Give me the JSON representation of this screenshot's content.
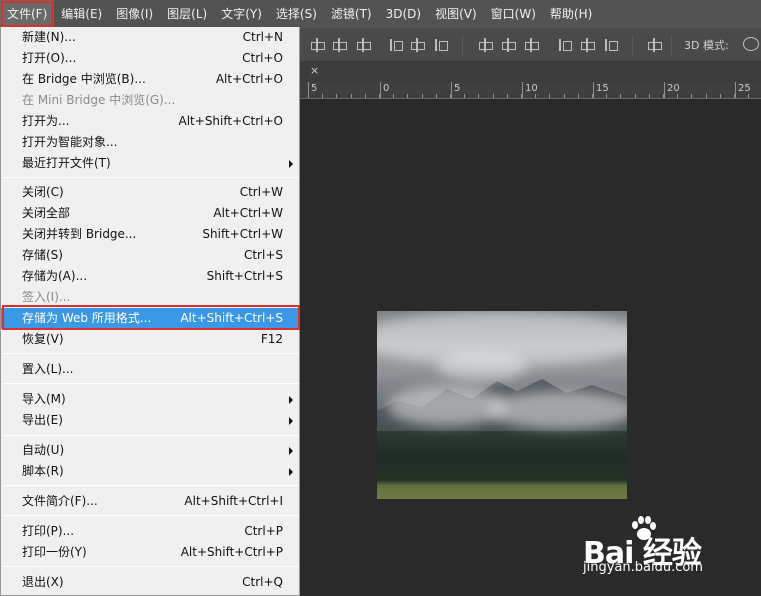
{
  "menubar": {
    "items": [
      "文件(F)",
      "编辑(E)",
      "图像(I)",
      "图层(L)",
      "文字(Y)",
      "选择(S)",
      "滤镜(T)",
      "3D(D)",
      "视图(V)",
      "窗口(W)",
      "帮助(H)"
    ]
  },
  "options": {
    "mode3d_label": "3D 模式:"
  },
  "tab": {
    "close": "×"
  },
  "ruler": {
    "labels": [
      "5",
      "0",
      "5",
      "10",
      "15",
      "20",
      "25"
    ]
  },
  "file_menu": {
    "items": [
      {
        "label": "新建(N)...",
        "shortcut": "Ctrl+N"
      },
      {
        "label": "打开(O)...",
        "shortcut": "Ctrl+O"
      },
      {
        "label": "在 Bridge 中浏览(B)...",
        "shortcut": "Alt+Ctrl+O"
      },
      {
        "label": "在 Mini Bridge 中浏览(G)...",
        "shortcut": "",
        "disabled": true
      },
      {
        "label": "打开为...",
        "shortcut": "Alt+Shift+Ctrl+O"
      },
      {
        "label": "打开为智能对象...",
        "shortcut": ""
      },
      {
        "label": "最近打开文件(T)",
        "shortcut": "",
        "submenu": true
      },
      {
        "label": "关闭(C)",
        "shortcut": "Ctrl+W"
      },
      {
        "label": "关闭全部",
        "shortcut": "Alt+Ctrl+W"
      },
      {
        "label": "关闭并转到 Bridge...",
        "shortcut": "Shift+Ctrl+W"
      },
      {
        "label": "存储(S)",
        "shortcut": "Ctrl+S"
      },
      {
        "label": "存储为(A)...",
        "shortcut": "Shift+Ctrl+S"
      },
      {
        "label": "签入(I)...",
        "shortcut": "",
        "disabled": true
      },
      {
        "label": "存储为 Web 所用格式...",
        "shortcut": "Alt+Shift+Ctrl+S",
        "highlighted": true
      },
      {
        "label": "恢复(V)",
        "shortcut": "F12"
      },
      {
        "label": "置入(L)...",
        "shortcut": ""
      },
      {
        "label": "导入(M)",
        "shortcut": "",
        "submenu": true
      },
      {
        "label": "导出(E)",
        "shortcut": "",
        "submenu": true
      },
      {
        "label": "自动(U)",
        "shortcut": "",
        "submenu": true
      },
      {
        "label": "脚本(R)",
        "shortcut": "",
        "submenu": true
      },
      {
        "label": "文件简介(F)...",
        "shortcut": "Alt+Shift+Ctrl+I"
      },
      {
        "label": "打印(P)...",
        "shortcut": "Ctrl+P"
      },
      {
        "label": "打印一份(Y)",
        "shortcut": "Alt+Shift+Ctrl+P"
      },
      {
        "label": "退出(X)",
        "shortcut": "Ctrl+Q"
      }
    ]
  },
  "watermark": {
    "logo": "Bai 经验",
    "url": "jingyan.baidu.com"
  },
  "colors": {
    "highlight": "#3a98e6",
    "annotation_red": "#d9302c",
    "menubar": "#535353",
    "canvas_bg": "#2b2a2b"
  }
}
